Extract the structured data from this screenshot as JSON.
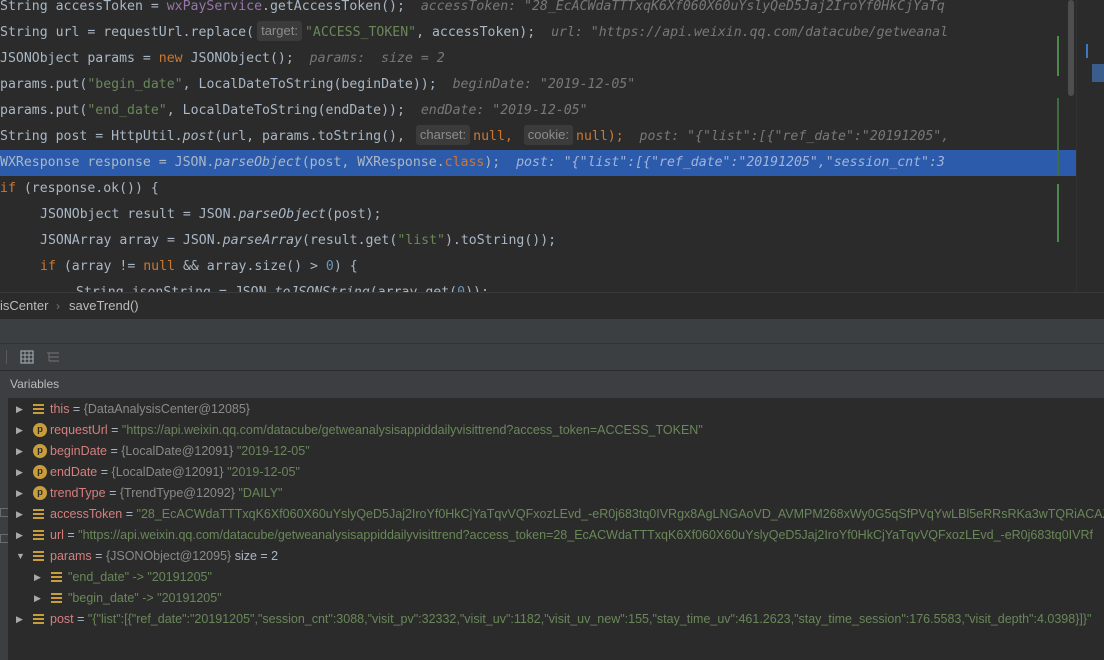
{
  "editor": {
    "lines": [
      {
        "id": "l1",
        "text": "String accessToken = wxPayService.getAccessToken();",
        "hint": "accessToken: \"28_EcACWdaTTTxqK6Xf060X60uYslyQeD5Jaj2IroYf0HkCjYaTq"
      },
      {
        "id": "l2",
        "pre": "String url = requestUrl.replace(",
        "p1": "target:",
        "arg1": "\"ACCESS_TOKEN\"",
        "post": ", accessToken);",
        "hint": "url: \"https://api.weixin.qq.com/datacube/getweanal"
      },
      {
        "id": "l3",
        "text": "JSONObject params = new JSONObject();",
        "hint": "params:  size = 2"
      },
      {
        "id": "l4",
        "text": "params.put(\"begin_date\", LocalDateToString(beginDate));",
        "hint": "beginDate: \"2019-12-05\""
      },
      {
        "id": "l5",
        "text": "params.put(\"end_date\", LocalDateToString(endDate));",
        "hint": "endDate: \"2019-12-05\""
      },
      {
        "id": "l6",
        "pre": "String post = HttpUtil.post(url, params.toString(),",
        "p1": "charset:",
        "arg1": "null,",
        "p2": "cookie:",
        "arg2": "null);",
        "hint": "post: \"{\"list\":[{\"ref_date\":\"20191205\","
      },
      {
        "id": "l7",
        "text": "WXResponse response = JSON.parseObject(post, WXResponse.class);",
        "hint": "post: \"{\"list\":[{\"ref_date\":\"20191205\",\"session_cnt\":3"
      },
      {
        "id": "l8",
        "text": "if (response.ok()) {"
      },
      {
        "id": "l9",
        "text": "JSONObject result = JSON.parseObject(post);"
      },
      {
        "id": "l10",
        "text": "JSONArray array = JSON.parseArray(result.get(\"list\").toString());"
      },
      {
        "id": "l11",
        "text": "if (array != null && array.size() > 0) {"
      },
      {
        "id": "l12",
        "text": "String jsonString = JSON.toJSONString(array.get(0));"
      }
    ]
  },
  "breadcrumb": {
    "item1": "isCenter",
    "separator": "›",
    "item2": "saveTrend()"
  },
  "panel": {
    "title": "Variables"
  },
  "variables": [
    {
      "name": "this",
      "type": "{DataAnalysisCenter@12085}",
      "value": "",
      "icon": "field"
    },
    {
      "name": "requestUrl",
      "type": "",
      "value": "\"https://api.weixin.qq.com/datacube/getweanalysisappiddailyvisittrend?access_token=ACCESS_TOKEN\"",
      "icon": "param"
    },
    {
      "name": "beginDate",
      "type": "{LocalDate@12091}",
      "value": "\"2019-12-05\"",
      "icon": "param"
    },
    {
      "name": "endDate",
      "type": "{LocalDate@12091}",
      "value": "\"2019-12-05\"",
      "icon": "param"
    },
    {
      "name": "trendType",
      "type": "{TrendType@12092}",
      "value": "\"DAILY\"",
      "icon": "param"
    },
    {
      "name": "accessToken",
      "type": "",
      "value": "\"28_EcACWdaTTTxqK6Xf060X60uYslyQeD5Jaj2IroYf0HkCjYaTqvVQFxozLEvd_-eR0j683tq0IVRgx8AgLNGAoVD_AVMPM268xWy0G5qSfPVqYwLBl5eRRsRKa3wTQRiACAZW",
      "icon": "field"
    },
    {
      "name": "url",
      "type": "",
      "value": "\"https://api.weixin.qq.com/datacube/getweanalysisappiddailyvisittrend?access_token=28_EcACWdaTTTxqK6Xf060X60uYslyQeD5Jaj2IroYf0HkCjYaTqvVQFxozLEvd_-eR0j683tq0IVRf",
      "icon": "field"
    },
    {
      "name": "params",
      "type": "{JSONObject@12095}",
      "value": " size = 2",
      "icon": "field",
      "expanded": true
    },
    {
      "name": "\"end_date\" -> \"20191205\"",
      "type": "",
      "value": "",
      "icon": "field",
      "child": true
    },
    {
      "name": "\"begin_date\" -> \"20191205\"",
      "type": "",
      "value": "",
      "icon": "field",
      "child": true
    },
    {
      "name": "post",
      "type": "",
      "value": "\"{\"list\":[{\"ref_date\":\"20191205\",\"session_cnt\":3088,\"visit_pv\":32332,\"visit_uv\":1182,\"visit_uv_new\":155,\"stay_time_uv\":461.2623,\"stay_time_session\":176.5583,\"visit_depth\":4.0398}]}\"",
      "icon": "field"
    }
  ]
}
